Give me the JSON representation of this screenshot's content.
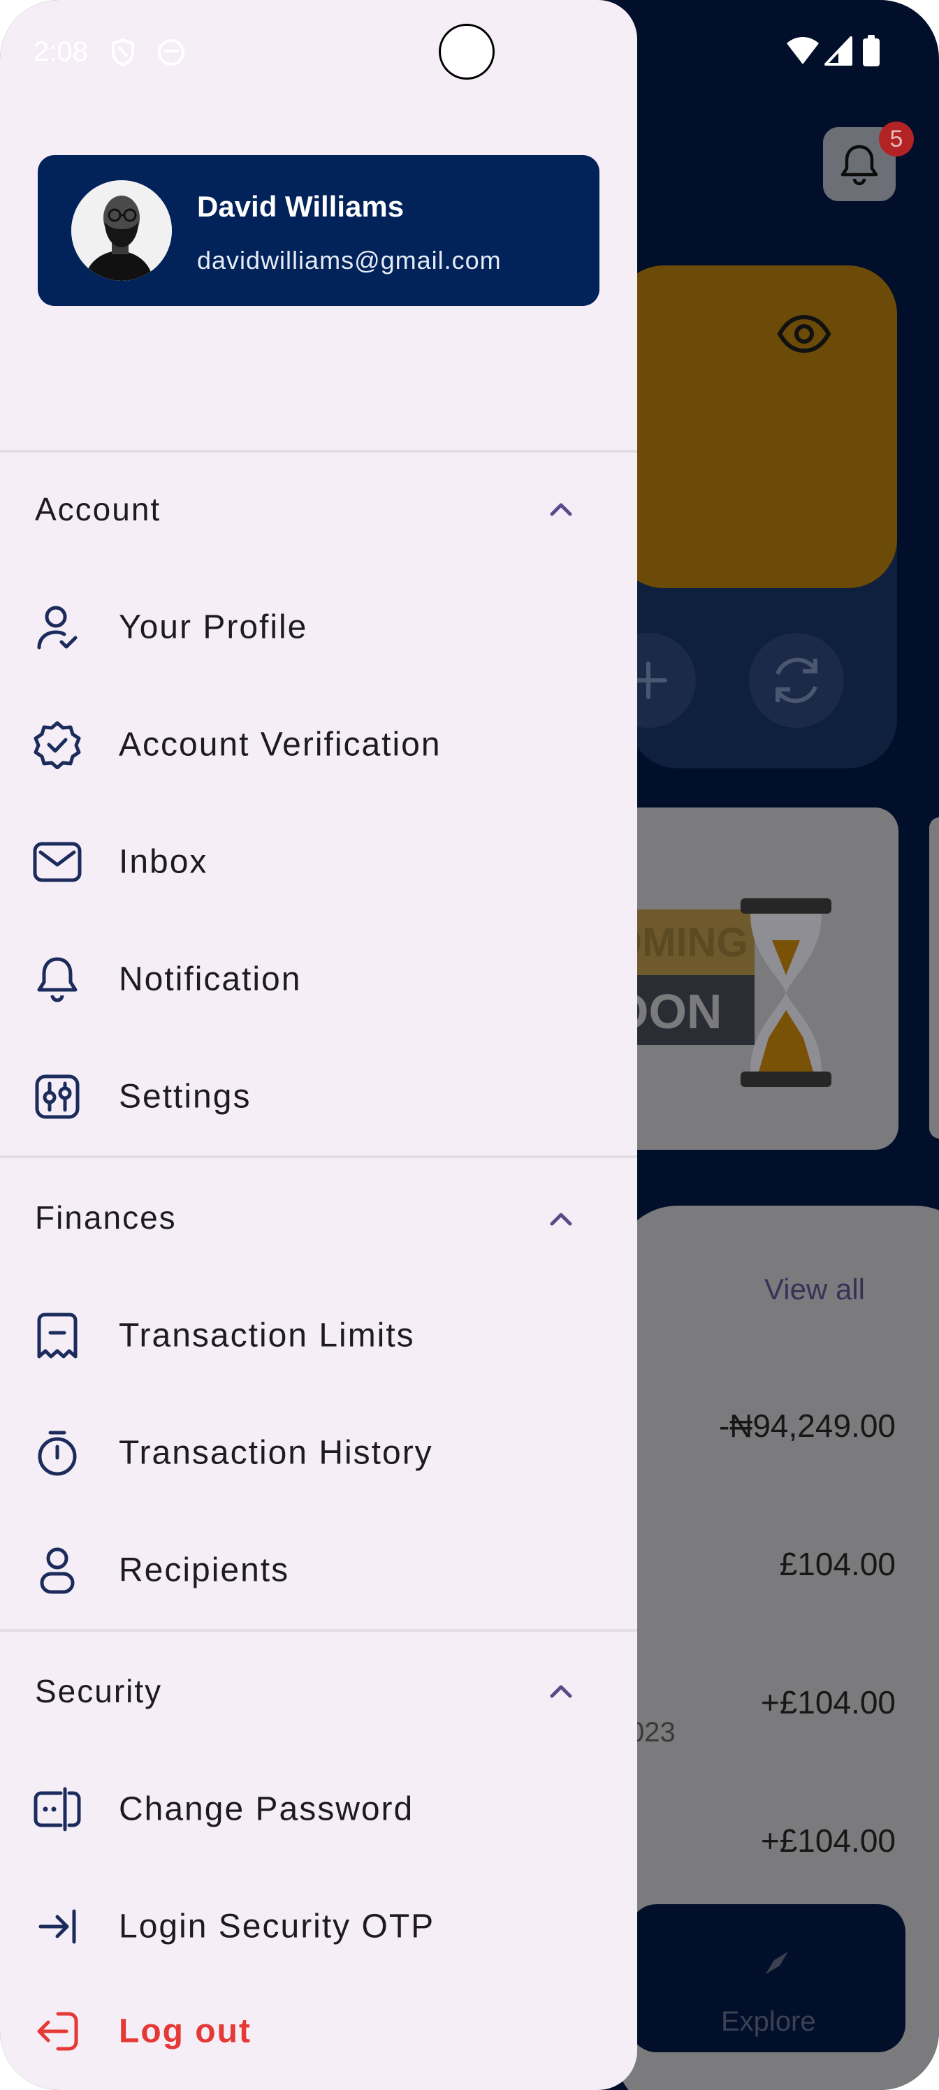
{
  "status_bar": {
    "time": "2:08"
  },
  "user": {
    "name": "David Williams",
    "email": "davidwilliams@gmail.com"
  },
  "sections": [
    {
      "title": "Account",
      "items": [
        {
          "label": "Your Profile",
          "icon": "user-check-icon"
        },
        {
          "label": "Account Verification",
          "icon": "verified-badge-icon"
        },
        {
          "label": "Inbox",
          "icon": "mail-icon"
        },
        {
          "label": "Notification",
          "icon": "bell-icon"
        },
        {
          "label": "Settings",
          "icon": "sliders-icon"
        }
      ]
    },
    {
      "title": "Finances",
      "items": [
        {
          "label": "Transaction Limits",
          "icon": "receipt-icon"
        },
        {
          "label": "Transaction History",
          "icon": "stopwatch-icon"
        },
        {
          "label": "Recipients",
          "icon": "person-icon"
        }
      ]
    },
    {
      "title": "Security",
      "items": [
        {
          "label": "Change Password",
          "icon": "password-icon"
        },
        {
          "label": "Login Security OTP",
          "icon": "login-icon"
        }
      ]
    }
  ],
  "logout": {
    "label": "Log out",
    "icon": "logout-icon"
  },
  "background": {
    "notification_count": "5",
    "view_all": "View all",
    "transactions": [
      "-₦94,249.00",
      "£104.00",
      "+£104.00",
      "+£104.00"
    ],
    "partial_date": "023",
    "promo_text_top": "OMING",
    "promo_text_bottom": "OON",
    "nav_explore": "Explore"
  },
  "colors": {
    "drawer_bg": "#f6eef7",
    "profile_card": "#02225a",
    "icon_navy": "#1b2c5c",
    "logout": "#e53935",
    "chevron": "#5a4a8a"
  }
}
